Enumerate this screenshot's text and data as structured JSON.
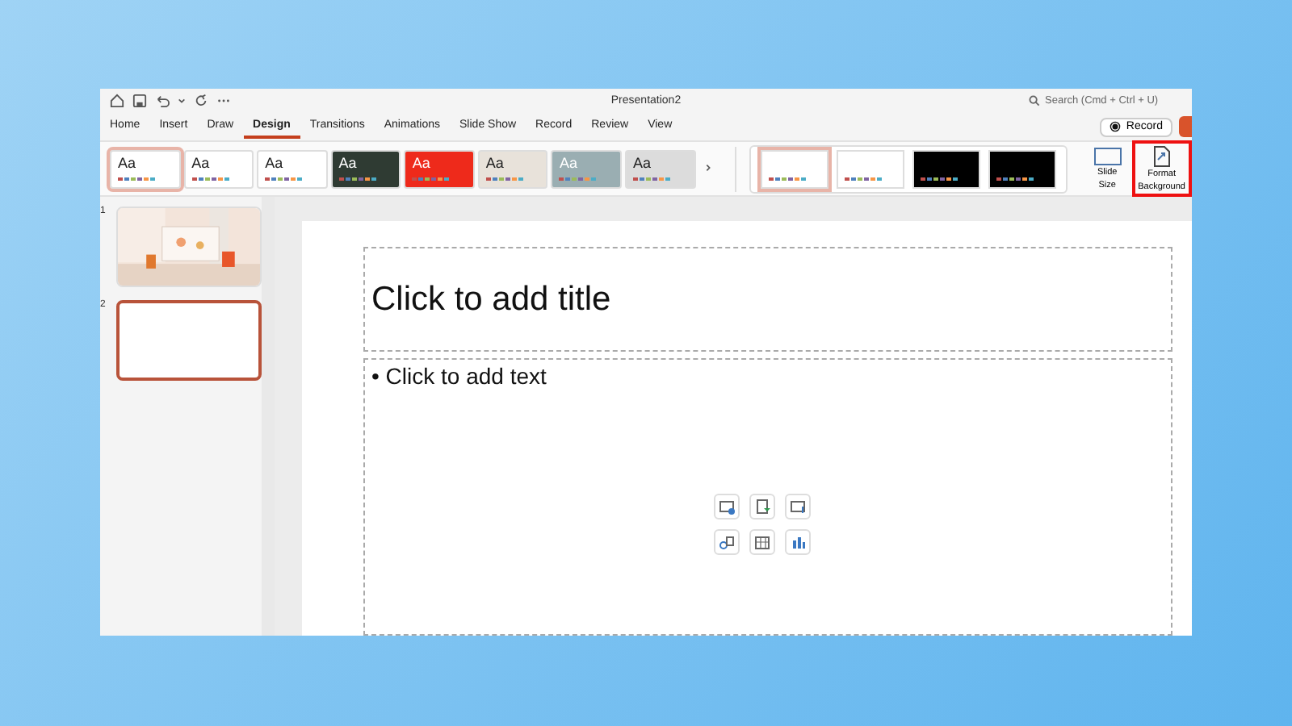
{
  "window": {
    "title": "Presentation2"
  },
  "search": {
    "placeholder": "Search (Cmd + Ctrl + U)"
  },
  "tabs": [
    {
      "label": "Home",
      "selected": false
    },
    {
      "label": "Insert",
      "selected": false
    },
    {
      "label": "Draw",
      "selected": false
    },
    {
      "label": "Design",
      "selected": true
    },
    {
      "label": "Transitions",
      "selected": false
    },
    {
      "label": "Animations",
      "selected": false
    },
    {
      "label": "Slide Show",
      "selected": false
    },
    {
      "label": "Record",
      "selected": false
    },
    {
      "label": "Review",
      "selected": false
    },
    {
      "label": "View",
      "selected": false
    }
  ],
  "record_button": {
    "label": "Record"
  },
  "themes": [
    {
      "label": "Aa",
      "selected": true,
      "color": "#ffffff"
    },
    {
      "label": "Aa",
      "selected": false,
      "color": "#ffffff"
    },
    {
      "label": "Aa",
      "selected": false,
      "color": "#ffffff"
    },
    {
      "label": "Aa",
      "selected": false,
      "color": "#2f3b33"
    },
    {
      "label": "Aa",
      "selected": false,
      "color": "#ee2a1b"
    },
    {
      "label": "Aa",
      "selected": false,
      "color": "#e8e2da"
    },
    {
      "label": "Aa",
      "selected": false,
      "color": "#9aaeb2"
    },
    {
      "label": "Aa",
      "selected": false,
      "color": "#dcdcdc"
    }
  ],
  "variants": [
    {
      "selected": true,
      "color": "#ffffff"
    },
    {
      "selected": false,
      "color": "#ffffff"
    },
    {
      "selected": false,
      "color": "#000000"
    },
    {
      "selected": false,
      "color": "#000000"
    }
  ],
  "ribbon_buttons": [
    {
      "kind": "slide-size",
      "label": "Slide Size",
      "highlighted": false
    },
    {
      "kind": "format-background",
      "label": "Format Background",
      "highlighted": true
    }
  ],
  "slides": [
    {
      "number": "1",
      "kind": "picture",
      "selected": false
    },
    {
      "number": "2",
      "kind": "blank",
      "selected": true
    }
  ],
  "slide": {
    "title_placeholder": "Click to add title",
    "body_placeholder": "• Click to add text"
  }
}
